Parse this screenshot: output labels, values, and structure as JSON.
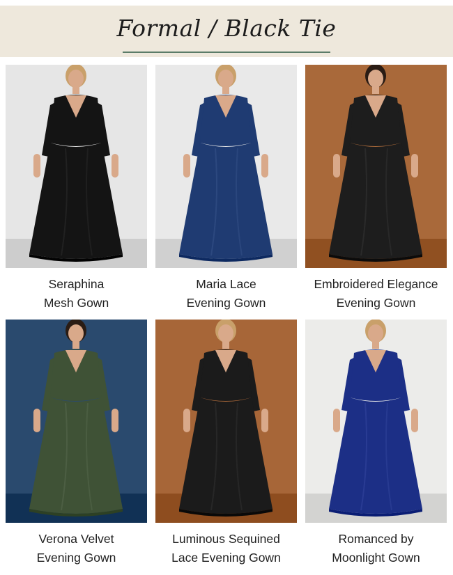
{
  "section": {
    "title": "Formal / Black Tie"
  },
  "products": [
    {
      "name_line1": "Seraphina",
      "name_line2": "Mesh Gown",
      "backdrop": "#e6e6e6",
      "dress_color": "#141414"
    },
    {
      "name_line1": "Maria Lace",
      "name_line2": "Evening Gown",
      "backdrop": "#e9e9e9",
      "dress_color": "#1f3b72"
    },
    {
      "name_line1": "Embroidered Elegance",
      "name_line2": "Evening Gown",
      "backdrop": "#a9693a",
      "dress_color": "#1d1d1d"
    },
    {
      "name_line1": "Verona Velvet",
      "name_line2": "Evening Gown",
      "backdrop": "#2a4a6e",
      "dress_color": "#3f5236"
    },
    {
      "name_line1": "Luminous Sequined",
      "name_line2": "Lace Evening Gown",
      "backdrop": "#a76638",
      "dress_color": "#1b1b1b"
    },
    {
      "name_line1": "Romanced by",
      "name_line2": "Moonlight Gown",
      "backdrop": "#ececea",
      "dress_color": "#1c2f86"
    }
  ]
}
